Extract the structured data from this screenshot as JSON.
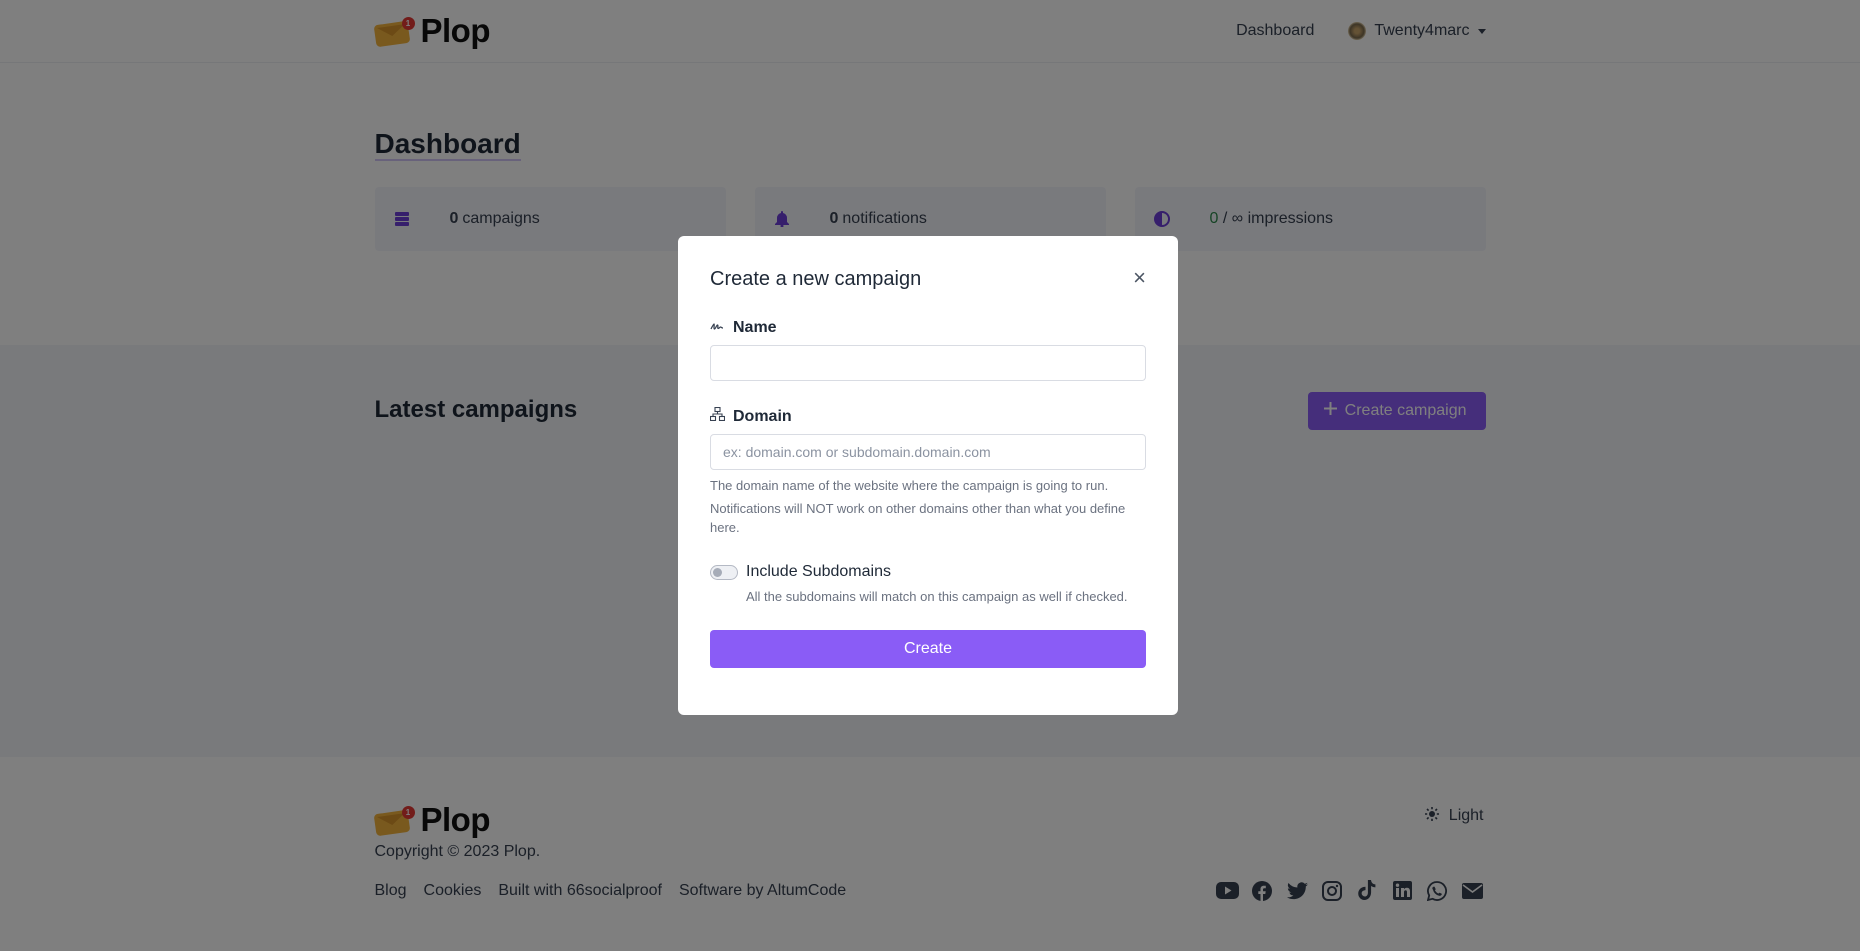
{
  "app": {
    "brand": "Plop",
    "logo_badge": "1"
  },
  "navbar": {
    "dashboard_link": "Dashboard",
    "username": "Twenty4marc"
  },
  "dashboard": {
    "title": "Dashboard",
    "stats": {
      "campaigns": {
        "count": "0",
        "label": "campaigns",
        "icon": "server-stack-icon"
      },
      "notifications": {
        "count": "0",
        "label": "notifications",
        "icon": "bell-icon"
      },
      "impressions": {
        "used": "0",
        "separator": " / ",
        "limit": "∞",
        "label": "impressions",
        "icon": "contrast-icon"
      }
    }
  },
  "latest": {
    "title": "Latest campaigns",
    "create_button": "Create campaign"
  },
  "footer": {
    "brand": "Plop",
    "copyright": "Copyright © 2023 Plop.",
    "theme_label": "Light",
    "links": [
      "Blog",
      "Cookies",
      "Built with 66socialproof",
      "Software by AltumCode"
    ],
    "socials": [
      "youtube-icon",
      "facebook-icon",
      "twitter-icon",
      "instagram-icon",
      "tiktok-icon",
      "linkedin-icon",
      "whatsapp-icon",
      "email-icon"
    ]
  },
  "modal": {
    "title": "Create a new campaign",
    "close": "×",
    "name_label": "Name",
    "name_value": "",
    "domain_label": "Domain",
    "domain_placeholder": "ex: domain.com or subdomain.domain.com",
    "domain_help_1": "The domain name of the website where the campaign is going to run.",
    "domain_help_2": "Notifications will NOT work on other domains other than what you define here.",
    "include_subdomains_label": "Include Subdomains",
    "include_subdomains_checked": false,
    "include_subdomains_help": "All the subdomains will match on this campaign as well if checked.",
    "submit": "Create"
  },
  "colors": {
    "accent": "#8a5cf6",
    "overlay": "rgba(0,0,0,0.5)",
    "green": "#2f8a4d"
  }
}
